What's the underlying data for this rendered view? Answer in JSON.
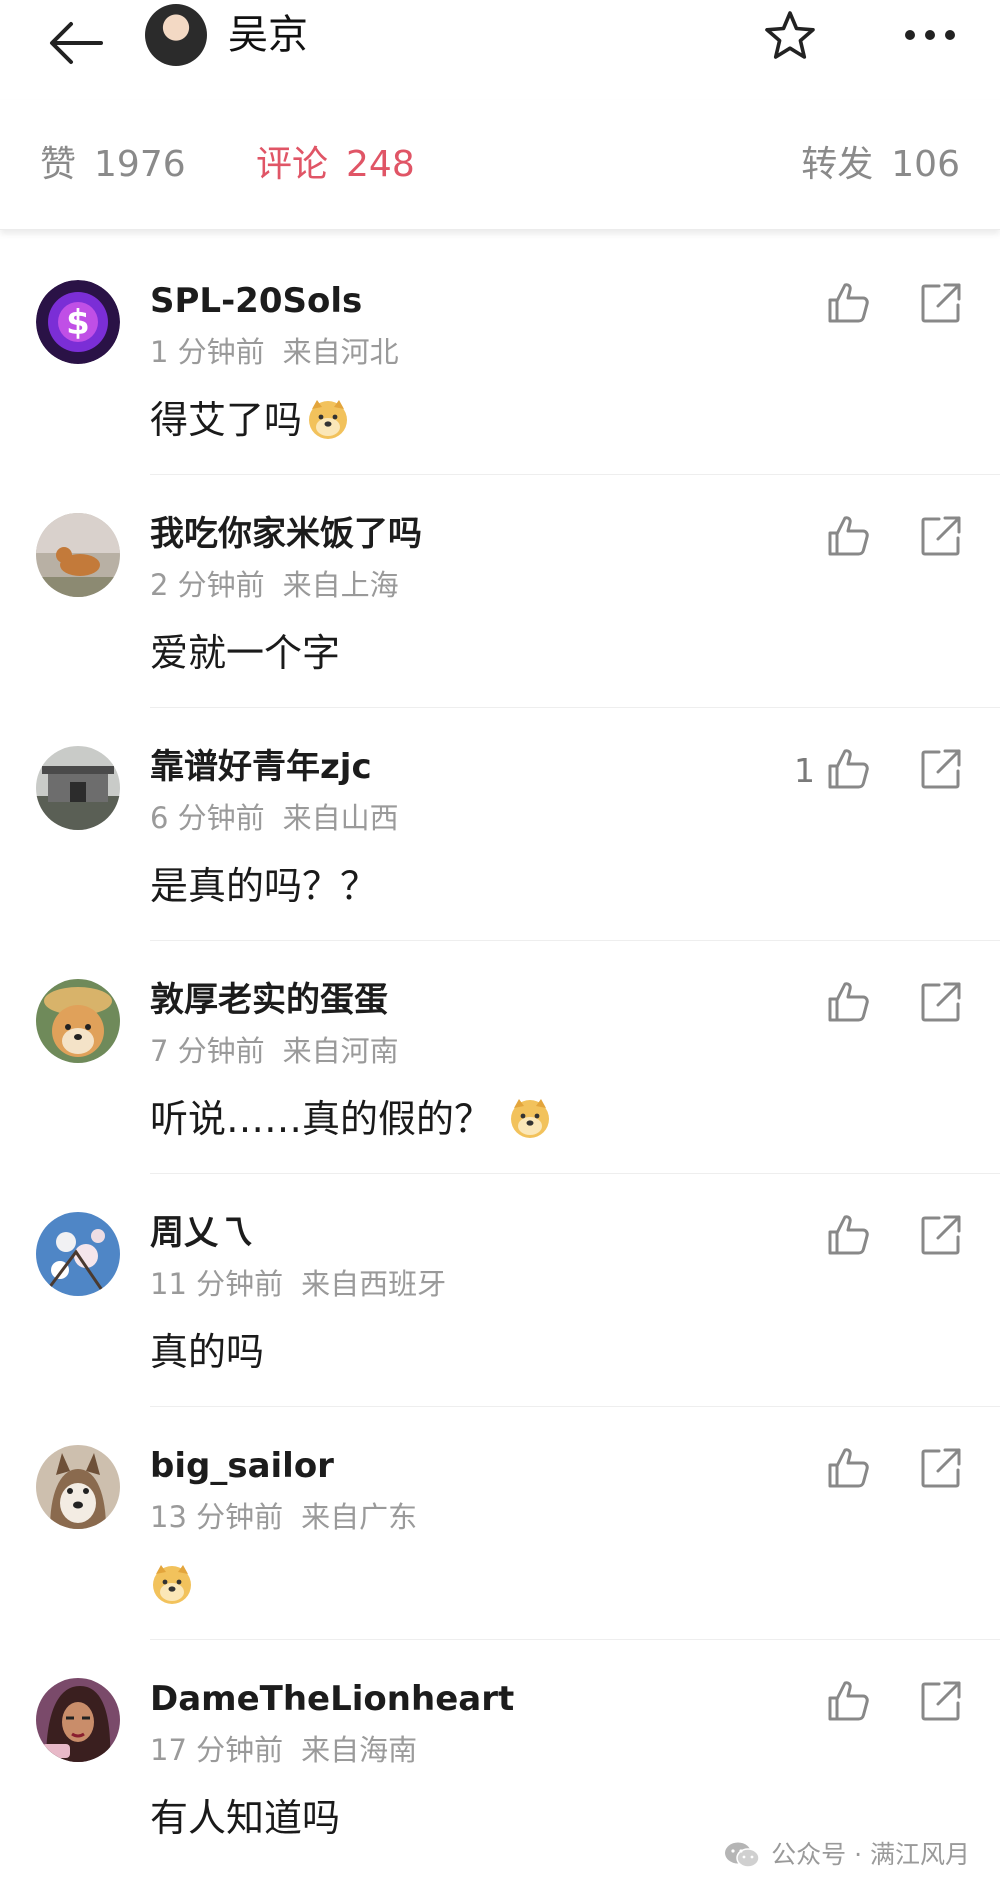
{
  "header": {
    "title": "吴京",
    "back_icon": "arrow-left-icon",
    "favorite_icon": "star-icon",
    "more_icon": "more-dots-icon"
  },
  "stats": {
    "likes_label": "赞",
    "likes_count": "1976",
    "comments_label": "评论",
    "comments_count": "248",
    "reposts_label": "转发",
    "reposts_count": "106",
    "active_color": "#e05566"
  },
  "comments": [
    {
      "name": "SPL-20Sols",
      "time": "1 分钟前",
      "location": "来自河北",
      "text": "得艾了吗",
      "emoji": "doge",
      "like_count": ""
    },
    {
      "name": "我吃你家米饭了吗",
      "time": "2 分钟前",
      "location": "来自上海",
      "text": "爱就一个字",
      "emoji": "",
      "like_count": ""
    },
    {
      "name": "靠谱好青年zjc",
      "time": "6 分钟前",
      "location": "来自山西",
      "text": "是真的吗？？",
      "emoji": "",
      "like_count": "1"
    },
    {
      "name": "敦厚老实的蛋蛋",
      "time": "7 分钟前",
      "location": "来自河南",
      "text": "听说……真的假的？",
      "emoji": "doge",
      "like_count": ""
    },
    {
      "name": "周乂乁",
      "time": "11 分钟前",
      "location": "来自西班牙",
      "text": "真的吗",
      "emoji": "",
      "like_count": ""
    },
    {
      "name": "big_sailor",
      "time": "13 分钟前",
      "location": "来自广东",
      "text": "",
      "emoji": "doge",
      "like_count": ""
    },
    {
      "name": "DameTheLionheart",
      "time": "17 分钟前",
      "location": "来自海南",
      "text": "有人知道吗",
      "emoji": "",
      "like_count": ""
    }
  ],
  "watermark": {
    "text": "公众号 · 满江风月"
  }
}
